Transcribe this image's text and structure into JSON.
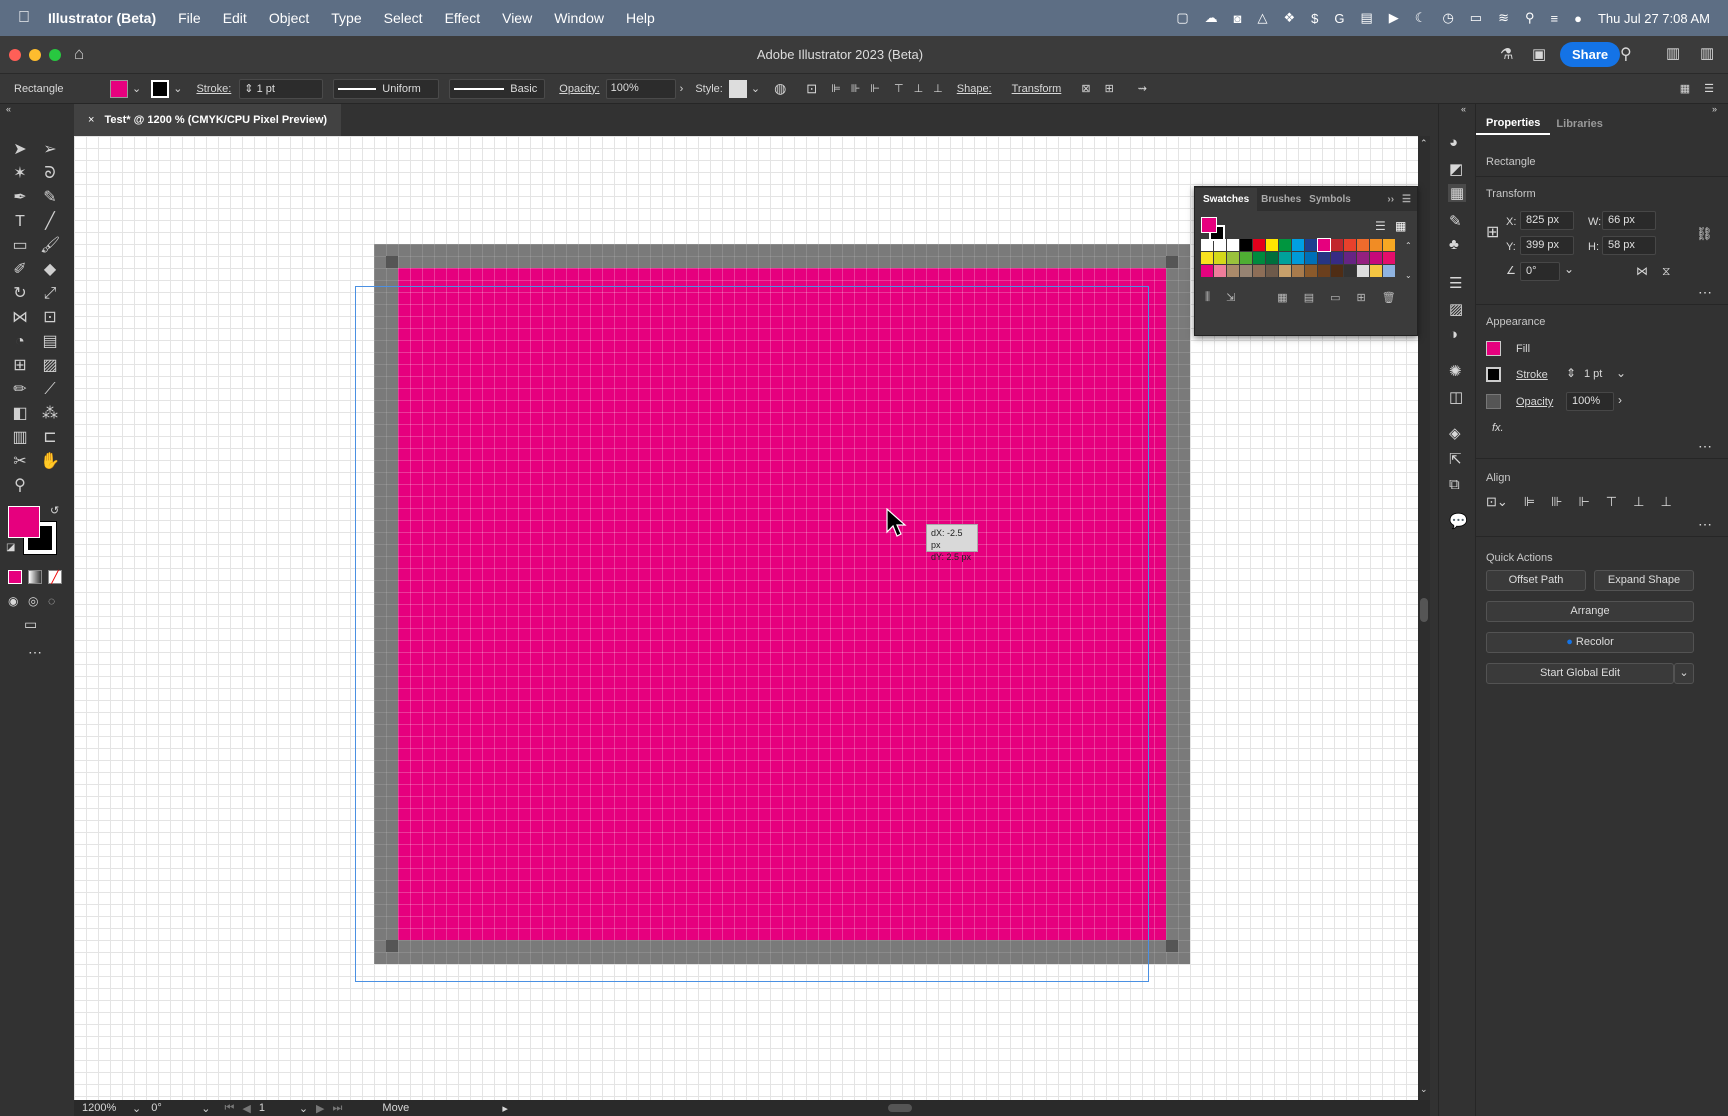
{
  "menubar": {
    "app": "Illustrator (Beta)",
    "items": [
      "File",
      "Edit",
      "Object",
      "Type",
      "Select",
      "Effect",
      "View",
      "Window",
      "Help"
    ],
    "datetime": "Thu Jul 27  7:08 AM"
  },
  "window": {
    "title": "Adobe Illustrator 2023 (Beta)",
    "share": "Share"
  },
  "control": {
    "object_type": "Rectangle",
    "stroke_label": "Stroke:",
    "stroke_value": "1 pt",
    "profile": "Uniform",
    "brush": "Basic",
    "opacity_label": "Opacity:",
    "opacity_value": "100%",
    "style_label": "Style:",
    "shape_label": "Shape:",
    "transform_label": "Transform",
    "fill_color": "#e6007e"
  },
  "document": {
    "tab_title": "Test* @ 1200 % (CMYK/CPU Pixel Preview)",
    "close": "×"
  },
  "canvas": {
    "rect_color": "#e6007e",
    "tooltip_dx": "dX: -2.5 px",
    "tooltip_dy": "dY: 2.5 px"
  },
  "status": {
    "zoom": "1200%",
    "rotation": "0°",
    "artboard": "1",
    "mode": "Move"
  },
  "swatches_panel": {
    "tabs": [
      "Swatches",
      "Brushes",
      "Symbols"
    ],
    "colors": [
      [
        "#ffffff",
        "#ffffff",
        "#ffffff",
        "#000000",
        "#e3001b",
        "#ffe600",
        "#00963f",
        "#009fe3",
        "#1d3f8f",
        "#e6007e",
        "#c1272d",
        "#e8412c",
        "#ef6b2c",
        "#f18c24",
        "#f7a823"
      ],
      [
        "#f9e11f",
        "#d4d91a",
        "#9ac23c",
        "#4fae33",
        "#008a3e",
        "#006f3c",
        "#00a19a",
        "#009ad9",
        "#0070b8",
        "#273583",
        "#372b83",
        "#662483",
        "#94207f",
        "#c6087a",
        "#e50e6b"
      ],
      [
        "#e4027f",
        "#ee7d9a",
        "#aa8a6a",
        "#968372",
        "#8d6e57",
        "#6e5a4a",
        "#c7a06b",
        "#a87b4c",
        "#8b5a2b",
        "#6b3f1d",
        "#4f2d15",
        "#333333",
        "#dddddd",
        "#f4c542",
        "#8fb3e0"
      ]
    ]
  },
  "properties": {
    "tabs": [
      "Properties",
      "Libraries"
    ],
    "object": "Rectangle",
    "transform_title": "Transform",
    "x_label": "X:",
    "x": "825 px",
    "y_label": "Y:",
    "y": "399 px",
    "w_label": "W:",
    "w": "66 px",
    "h_label": "H:",
    "h": "58 px",
    "angle": "0°",
    "appearance_title": "Appearance",
    "fill": "Fill",
    "stroke": "Stroke",
    "stroke_value": "1 pt",
    "opacity": "Opacity",
    "opacity_value": "100%",
    "fx": "fx.",
    "align_title": "Align",
    "quick_title": "Quick Actions",
    "offset_path": "Offset Path",
    "expand_shape": "Expand Shape",
    "arrange": "Arrange",
    "recolor": "Recolor",
    "global_edit": "Start Global Edit"
  },
  "colors": {
    "accent": "#1473e6",
    "magenta": "#e6007e",
    "selection": "#4a90e2"
  }
}
